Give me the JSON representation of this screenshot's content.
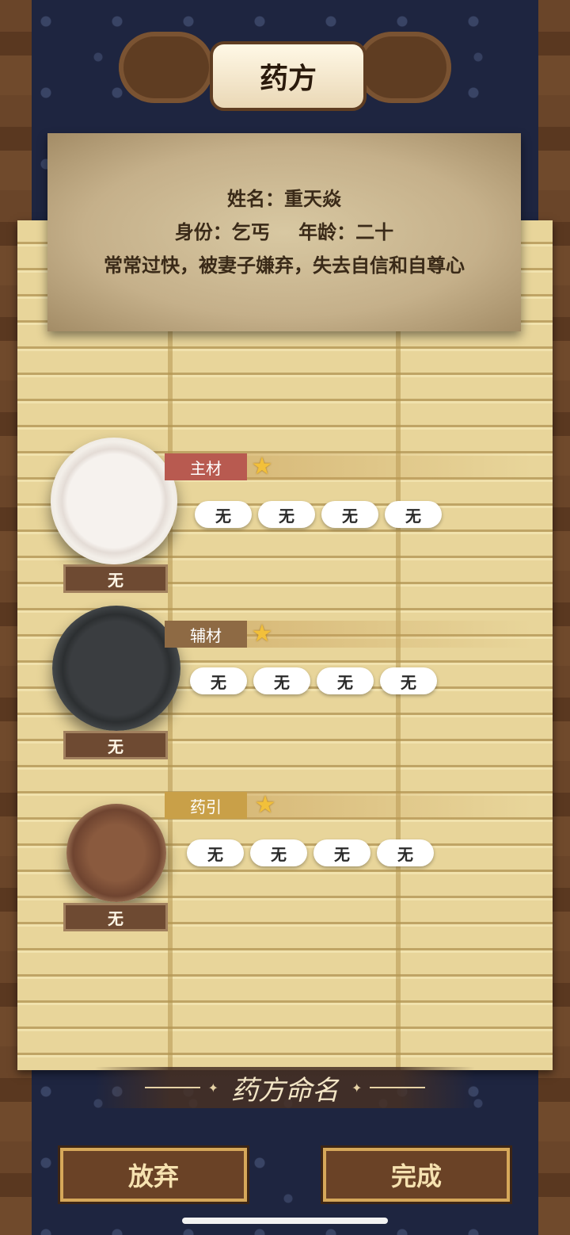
{
  "header": {
    "title": "药方"
  },
  "patient": {
    "name_line": "姓名：重天焱",
    "identity": "身份：乞丐",
    "age": "年龄：二十",
    "complaint": "常常过快，被妻子嫌弃，失去自信和自尊心"
  },
  "rows": [
    {
      "tag": "主材",
      "vessel_label": "无",
      "slots": [
        "无",
        "无",
        "无",
        "无"
      ]
    },
    {
      "tag": "辅材",
      "vessel_label": "无",
      "slots": [
        "无",
        "无",
        "无",
        "无"
      ]
    },
    {
      "tag": "药引",
      "vessel_label": "无",
      "slots": [
        "无",
        "无",
        "无",
        "无"
      ]
    }
  ],
  "naming": {
    "label": "药方命名",
    "star": "✦"
  },
  "buttons": {
    "giveup": "放弃",
    "done": "完成"
  },
  "icons": {
    "star": "star-icon"
  },
  "colors": {
    "tag_main": "#b85a50",
    "tag_aux": "#8e6a44",
    "tag_guide": "#c9a048",
    "star": "#f2c03a"
  }
}
